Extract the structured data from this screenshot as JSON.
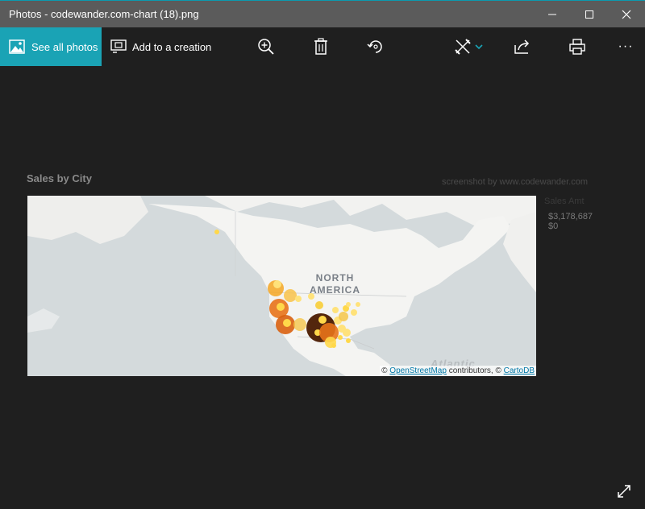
{
  "window": {
    "title": "Photos - codewander.com-chart (18).png",
    "controls": [
      "minimize-icon",
      "maximize-icon",
      "close-icon"
    ]
  },
  "toolbar": {
    "see_all_label": "See all photos",
    "add_creation_label": "Add to a creation",
    "icons": [
      "zoom-in-icon",
      "delete-icon",
      "rotate-icon",
      "edit-icon",
      "share-icon",
      "print-icon",
      "more-icon"
    ],
    "more_label": "···"
  },
  "image": {
    "chart_title": "Sales by City",
    "watermark": "screenshot by www.codewander.com",
    "legend": {
      "title": "Sales Amt",
      "max": "$3,178,687",
      "min": "$0"
    },
    "map_labels": {
      "region_line1": "NORTH",
      "region_line2": "AMERICA",
      "ocean": "Atlantic"
    },
    "attribution": {
      "prefix": "©",
      "osm": "OpenStreetMap",
      "middle": "contributors, ©",
      "carto": "CartoDB"
    }
  },
  "colors": {
    "accent": "#1aa3b5",
    "titlebar": "#5b5b5b",
    "background": "#1f1f1f"
  }
}
